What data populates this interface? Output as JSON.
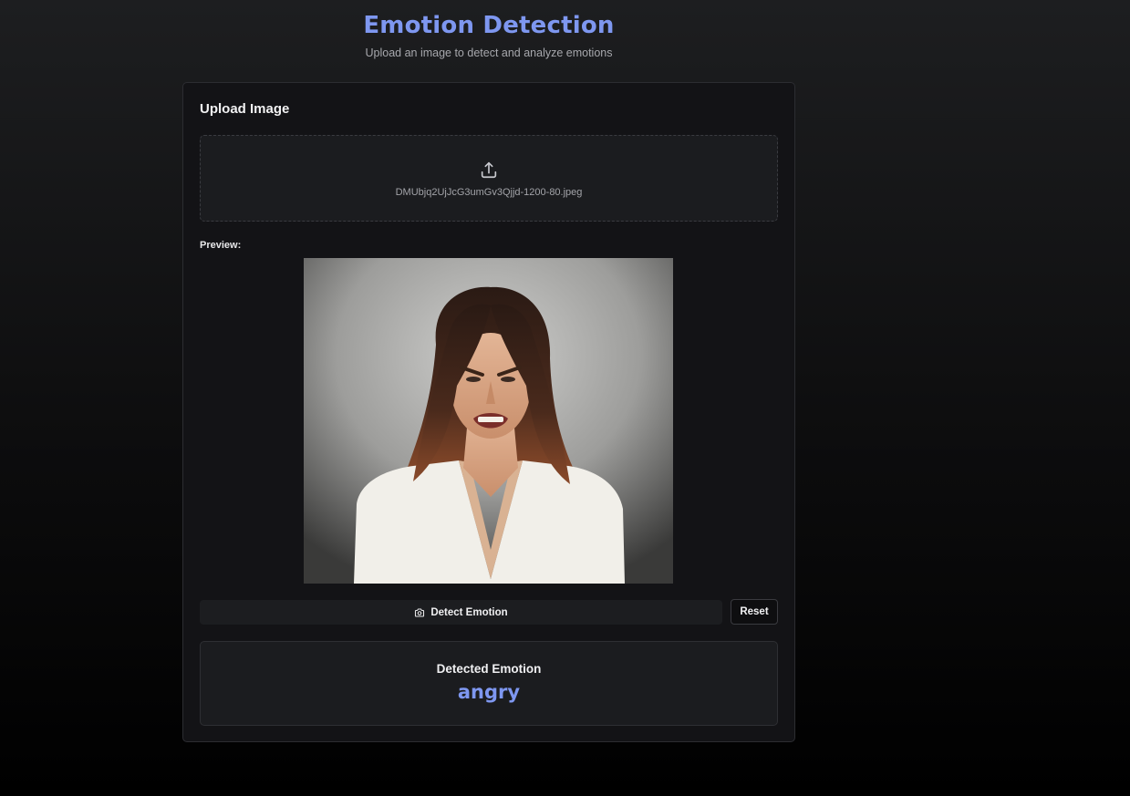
{
  "header": {
    "title": "Emotion Detection",
    "subtitle": "Upload an image to detect and analyze emotions"
  },
  "upload": {
    "card_title": "Upload Image",
    "icon": "upload-icon",
    "file_name": "DMUbjq2UjJcG3umGv3Qjjd-1200-80.jpeg"
  },
  "preview": {
    "label": "Preview:"
  },
  "actions": {
    "detect_label": "Detect Emotion",
    "detect_icon": "camera-icon",
    "reset_label": "Reset"
  },
  "result": {
    "label": "Detected Emotion",
    "emotion": "angry"
  },
  "colors": {
    "accent": "#7e97f0",
    "background": "#0d0d0e",
    "card": "#131316"
  }
}
